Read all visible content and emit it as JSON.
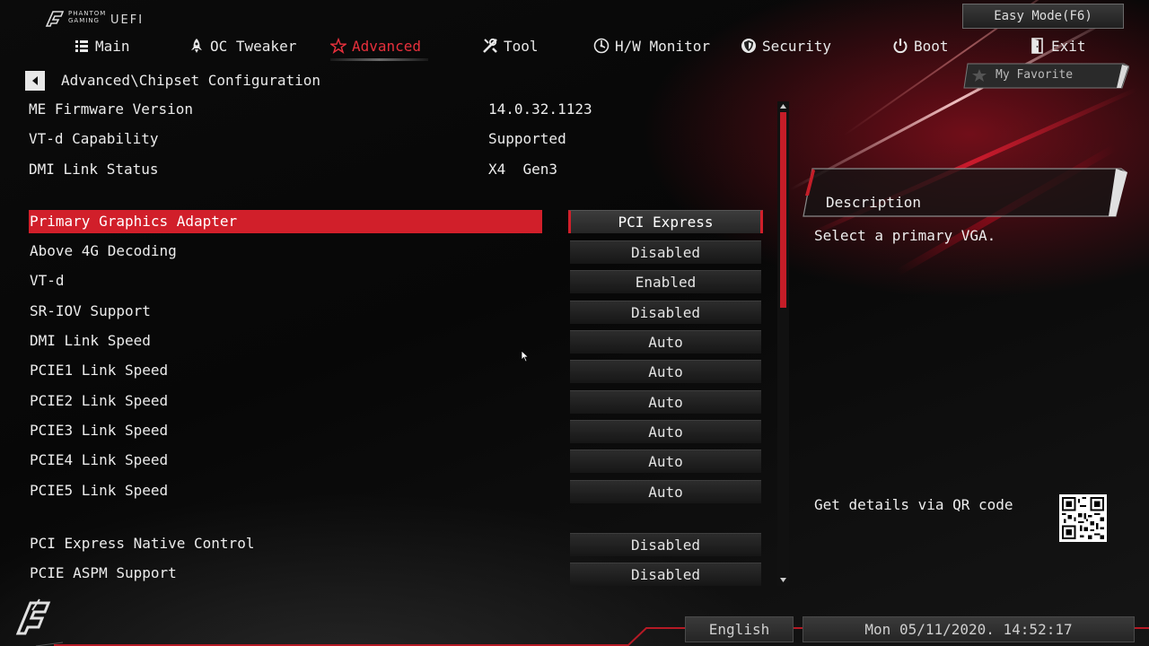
{
  "brand": {
    "line1": "PHANTOM",
    "line2": "GAMING",
    "uefi": "UEFI"
  },
  "easy_mode": "Easy Mode(F6)",
  "nav": [
    {
      "label": "Main",
      "icon": "list-icon"
    },
    {
      "label": "OC Tweaker",
      "icon": "rocket-icon"
    },
    {
      "label": "Advanced",
      "icon": "star-icon",
      "active": true
    },
    {
      "label": "Tool",
      "icon": "tools-icon"
    },
    {
      "label": "H/W Monitor",
      "icon": "monitor-icon"
    },
    {
      "label": "Security",
      "icon": "shield-icon"
    },
    {
      "label": "Boot",
      "icon": "power-icon"
    },
    {
      "label": "Exit",
      "icon": "exit-door-icon"
    }
  ],
  "breadcrumb": "Advanced\\Chipset Configuration",
  "my_favorite": "My Favorite",
  "info": [
    {
      "label": "ME Firmware Version",
      "value": "14.0.32.1123"
    },
    {
      "label": "VT-d Capability",
      "value": "Supported"
    },
    {
      "label": "DMI Link Status",
      "value": "X4  Gen3"
    }
  ],
  "settings": [
    {
      "label": "Primary Graphics Adapter",
      "value": "PCI Express",
      "selected": true
    },
    {
      "label": "Above 4G Decoding",
      "value": "Disabled"
    },
    {
      "label": "VT-d",
      "value": "Enabled"
    },
    {
      "label": "SR-IOV Support",
      "value": "Disabled"
    },
    {
      "label": "DMI Link Speed",
      "value": "Auto"
    },
    {
      "label": "PCIE1 Link Speed",
      "value": "Auto"
    },
    {
      "label": "PCIE2 Link Speed",
      "value": "Auto"
    },
    {
      "label": "PCIE3 Link Speed",
      "value": "Auto"
    },
    {
      "label": "PCIE4 Link Speed",
      "value": "Auto"
    },
    {
      "label": "PCIE5 Link Speed",
      "value": "Auto"
    },
    {
      "label": "PCI Express Native Control",
      "value": "Disabled"
    },
    {
      "label": "PCIE ASPM Support",
      "value": "Disabled"
    }
  ],
  "description": {
    "title": "Description",
    "text": "Select a primary VGA."
  },
  "qr_label": "Get details via QR code",
  "language": "English",
  "datetime": "Mon 05/11/2020. 14:52:17",
  "colors": {
    "accent": "#d11f2a",
    "active_nav": "#e8303c",
    "text": "#ececec"
  }
}
